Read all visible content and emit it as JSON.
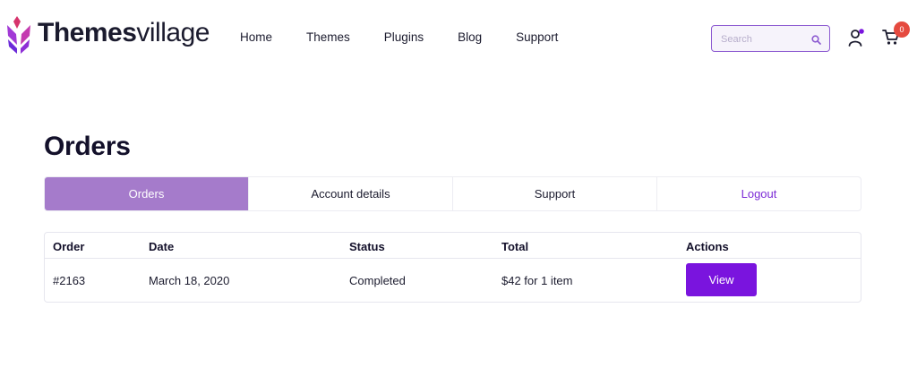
{
  "brand": {
    "name_bold": "Themes",
    "name_light": "village",
    "accent": "#7a14de"
  },
  "nav": {
    "items": [
      "Home",
      "Themes",
      "Plugins",
      "Blog",
      "Support"
    ]
  },
  "search": {
    "placeholder": "Search"
  },
  "cart": {
    "count": "0"
  },
  "page": {
    "title": "Orders"
  },
  "tabs": {
    "items": [
      {
        "label": "Orders",
        "active": true
      },
      {
        "label": "Account details",
        "active": false
      },
      {
        "label": "Support",
        "active": false
      },
      {
        "label": "Logout",
        "active": false
      }
    ]
  },
  "orders": {
    "columns": [
      "Order",
      "Date",
      "Status",
      "Total",
      "Actions"
    ],
    "rows": [
      {
        "order": "#2163",
        "date": "March 18, 2020",
        "status": "Completed",
        "total": "$42 for 1 item",
        "action": "View"
      }
    ]
  },
  "icons": {
    "logo": "leaf-logo-icon",
    "search": "search-icon",
    "user": "user-icon",
    "cart": "cart-icon"
  }
}
